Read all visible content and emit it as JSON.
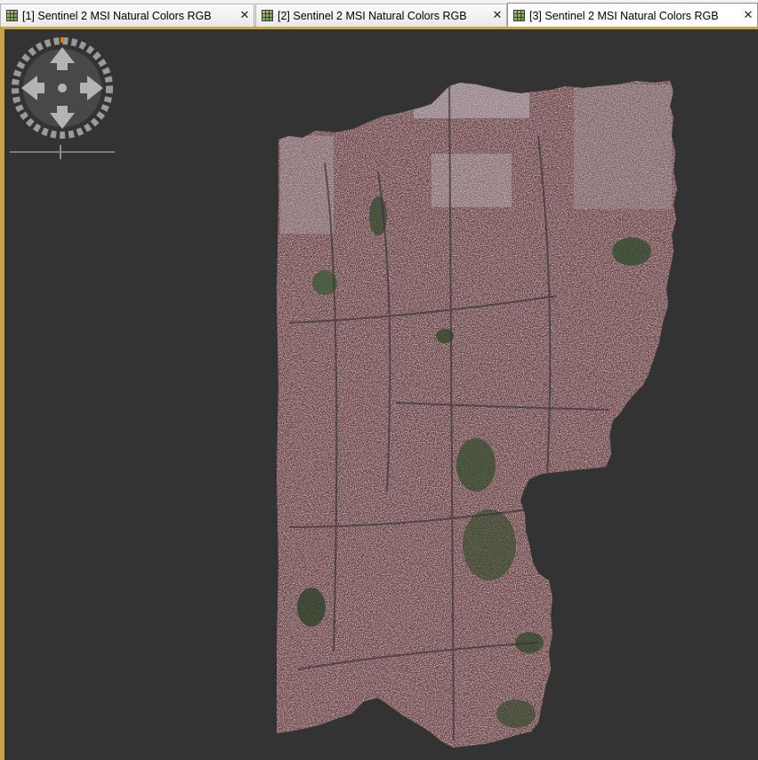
{
  "tabs": [
    {
      "label": "[1] Sentinel 2 MSI Natural Colors RGB",
      "close": "✕",
      "active": false
    },
    {
      "label": "[2] Sentinel 2 MSI Natural Colors RGB",
      "close": "✕",
      "active": false
    },
    {
      "label": "[3] Sentinel 2 MSI Natural Colors RGB",
      "close": "✕",
      "active": true
    }
  ],
  "icons": {
    "tab": "image-view-icon",
    "close": "close-icon",
    "navigation": "pan-navigation-icon",
    "zoom": "zoom-slider"
  },
  "colors": {
    "background": "#333333",
    "frame_accent": "#c9a34a",
    "raster_base": "#8a6e6e",
    "raster_urban": "#9b7470",
    "raster_vegetation": "#2f4a2c",
    "raster_bright": "#c8c6cc"
  }
}
